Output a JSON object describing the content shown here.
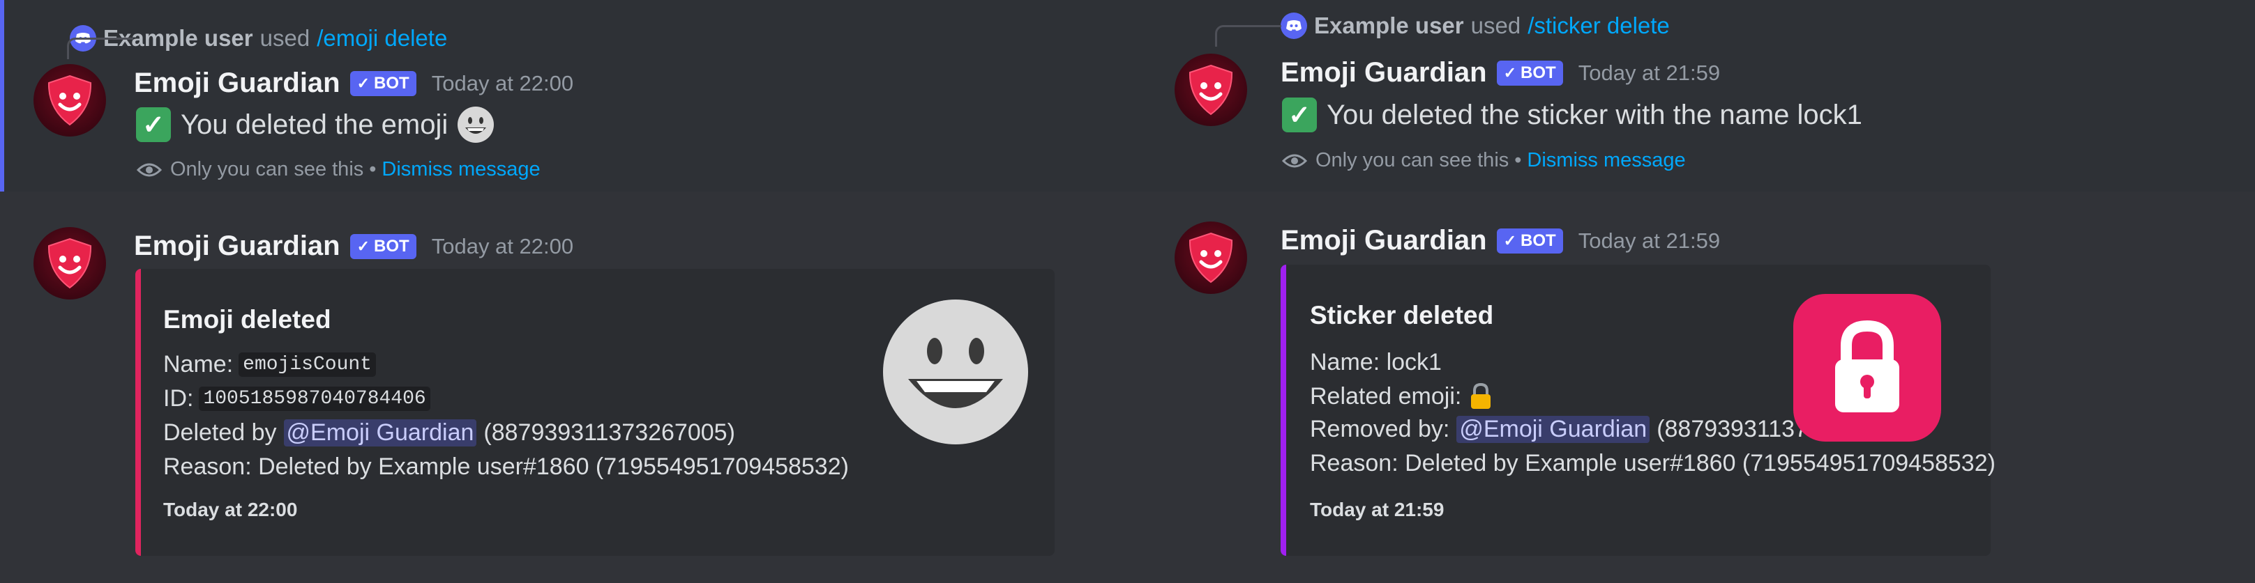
{
  "left": {
    "reply": {
      "username": "Example user",
      "used": "used",
      "command": "/emoji delete"
    },
    "ephemeral": {
      "author": "Emoji Guardian",
      "badge": "BOT",
      "timestamp": "Today at 22:00",
      "text": "You deleted the emoji",
      "only_you": "Only you can see this",
      "separator": "•",
      "dismiss": "Dismiss message"
    },
    "log": {
      "author": "Emoji Guardian",
      "badge": "BOT",
      "timestamp": "Today at 22:00",
      "embed": {
        "color": "#e0245e",
        "title": "Emoji deleted",
        "name_label": "Name:",
        "name_value": "emojisCount",
        "id_label": "ID:",
        "id_value": "1005185987040784406",
        "deleted_by_label": "Deleted by",
        "mention": "@Emoji Guardian",
        "mention_id": "(887939311373267005)",
        "reason": "Reason: Deleted by Example user#1860 (719554951709458532)",
        "footer": "Today at 22:00",
        "thumbnail_icon": "grinning-face-icon"
      }
    }
  },
  "right": {
    "reply": {
      "username": "Example user",
      "used": "used",
      "command": "/sticker delete"
    },
    "ephemeral": {
      "author": "Emoji Guardian",
      "badge": "BOT",
      "timestamp": "Today at 21:59",
      "text": "You deleted the sticker with the name lock1",
      "only_you": "Only you can see this",
      "separator": "•",
      "dismiss": "Dismiss message"
    },
    "log": {
      "author": "Emoji Guardian",
      "badge": "BOT",
      "timestamp": "Today at 21:59",
      "embed": {
        "color": "#a020f0",
        "title": "Sticker deleted",
        "name_line": "Name: lock1",
        "related_label": "Related emoji:",
        "removed_by_label": "Removed by:",
        "mention": "@Emoji Guardian",
        "mention_id": "(887939311373267005)",
        "reason": "Reason: Deleted by Example user#1860 (719554951709458532)",
        "footer": "Today at 21:59",
        "thumbnail_icon": "lock-sticker-icon",
        "thumbnail_color": "#e91e63"
      }
    }
  }
}
